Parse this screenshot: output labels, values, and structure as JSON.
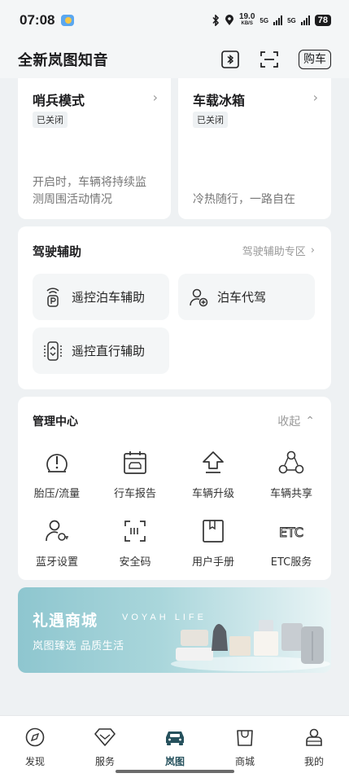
{
  "status_bar": {
    "time": "07:08",
    "speed_value": "19.0",
    "speed_unit": "KB/S",
    "net1": "5G",
    "net2": "5G",
    "battery": "78",
    "icons": [
      "weather-icon",
      "bluetooth-icon",
      "location-icon",
      "signal-icon"
    ]
  },
  "header": {
    "title": "全新岚图知音",
    "buy_label": "购车",
    "icons": [
      "bluetooth-key-icon",
      "scan-icon"
    ]
  },
  "top_cards": [
    {
      "title": "哨兵模式",
      "badge": "已关闭",
      "desc_line1": "开启时，车辆将持续监",
      "desc_line2": "测周围活动情况"
    },
    {
      "title": "车载冰箱",
      "badge": "已关闭",
      "desc_line1": "冷热随行，一路自在"
    }
  ],
  "driving_assist": {
    "title": "驾驶辅助",
    "link": "驾驶辅助专区",
    "buttons": [
      {
        "label": "遥控泊车辅助",
        "icon": "remote-parking-icon"
      },
      {
        "label": "泊车代驾",
        "icon": "valet-parking-icon"
      },
      {
        "label": "遥控直行辅助",
        "icon": "remote-straight-icon"
      }
    ]
  },
  "management": {
    "title": "管理中心",
    "collapse": "收起",
    "items": [
      {
        "label": "胎压/流量",
        "icon": "tire-pressure-icon"
      },
      {
        "label": "行车报告",
        "icon": "driving-report-icon"
      },
      {
        "label": "车辆升级",
        "icon": "vehicle-upgrade-icon"
      },
      {
        "label": "车辆共享",
        "icon": "vehicle-share-icon"
      },
      {
        "label": "蓝牙设置",
        "icon": "bluetooth-settings-icon"
      },
      {
        "label": "安全码",
        "icon": "security-code-icon"
      },
      {
        "label": "用户手册",
        "icon": "user-manual-icon"
      },
      {
        "label": "ETC服务",
        "icon": "etc-service-icon"
      }
    ]
  },
  "banner": {
    "title": "礼遇商城",
    "brand": "VOYAH LIFE",
    "subtitle": "岚图臻选 品质生活"
  },
  "tab_bar": {
    "active": "岚图",
    "tabs": [
      {
        "label": "发现",
        "icon": "discover-icon"
      },
      {
        "label": "服务",
        "icon": "service-icon"
      },
      {
        "label": "岚图",
        "icon": "car-icon"
      },
      {
        "label": "商城",
        "icon": "shop-icon"
      },
      {
        "label": "我的",
        "icon": "profile-icon"
      }
    ]
  },
  "colors": {
    "background": "#eef1f3",
    "accent": "#26515d",
    "banner": "#8ec6cf"
  }
}
